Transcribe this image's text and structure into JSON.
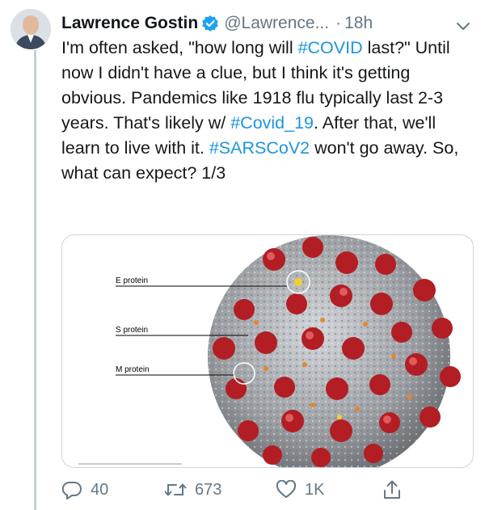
{
  "tweet": {
    "author": {
      "name": "Lawrence Gostin",
      "handle": "@Lawrence...",
      "verified": true
    },
    "time": "18h",
    "separator": "·",
    "text": {
      "p1": "I'm often asked, \"how long will ",
      "tag1": "#COVID",
      "p2": " last?\" Until now I didn't have a clue, but I think it's getting obvious. Pandemics like 1918 flu typically last 2-3 years. That's likely w/ ",
      "tag2": "#Covid_19",
      "p3": ". After that, we'll learn to live with it. ",
      "tag3": "#SARSCoV2",
      "p4": " won't go away. So, what can expect? 1/3"
    },
    "media": {
      "labels": [
        "E protein",
        "S protein",
        "M protein"
      ]
    },
    "actions": {
      "replies": "40",
      "retweets": "673",
      "likes": "1K"
    }
  },
  "colors": {
    "link": "#1b95e0",
    "muted": "#657786",
    "verified": "#1da1f2",
    "spike": "#b21e23",
    "virus_body": "#9a9ea3"
  },
  "icons": [
    "verified-badge-icon",
    "chevron-down-icon",
    "reply-icon",
    "retweet-icon",
    "like-icon",
    "share-icon"
  ]
}
